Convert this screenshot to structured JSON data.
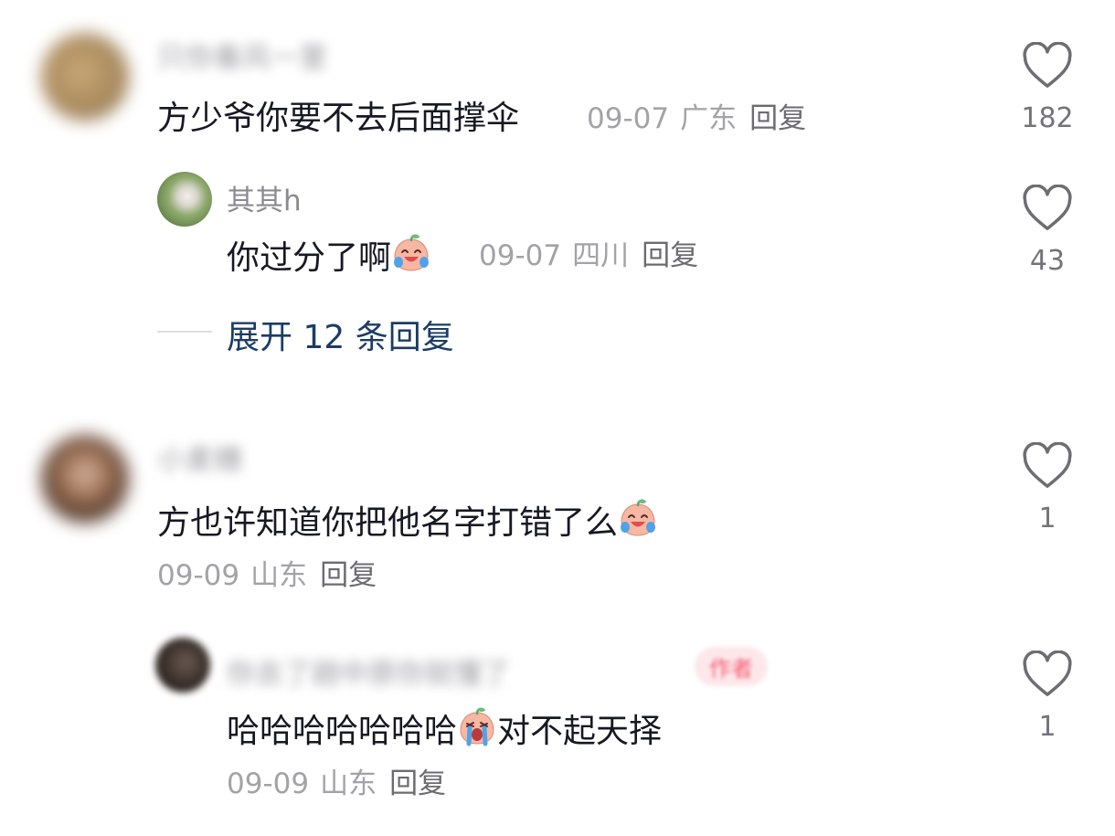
{
  "comments": [
    {
      "username": "只你春风一里",
      "text": "方少爷你要不去后面撑伞",
      "date": "09-07",
      "region": "广东",
      "reply_label": "回复",
      "likes": "182"
    },
    {
      "username": "其其h",
      "text": "你过分了啊",
      "date": "09-07",
      "region": "四川",
      "reply_label": "回复",
      "likes": "43"
    },
    {
      "username": "小麦穗",
      "text": "方也许知道你把他名字打错了么",
      "date": "09-09",
      "region": "山东",
      "reply_label": "回复",
      "likes": "1"
    },
    {
      "username": "你去了趟中原你就懂了",
      "author_badge": "作者",
      "text_before": "哈哈哈哈哈哈哈",
      "text_after": "对不起天择",
      "date": "09-09",
      "region": "山东",
      "reply_label": "回复",
      "likes": "1"
    }
  ],
  "expand_replies": "展开 12 条回复",
  "icons": {
    "like": "heart-outline-icon",
    "emoji_laugh_cry": "laugh-cry-emoji-icon",
    "emoji_cry": "crying-emoji-icon"
  },
  "colors": {
    "text": "#161823",
    "meta": "#a2a3a8",
    "expand_link": "#1c3c66",
    "author_badge": "#f25a6f"
  }
}
